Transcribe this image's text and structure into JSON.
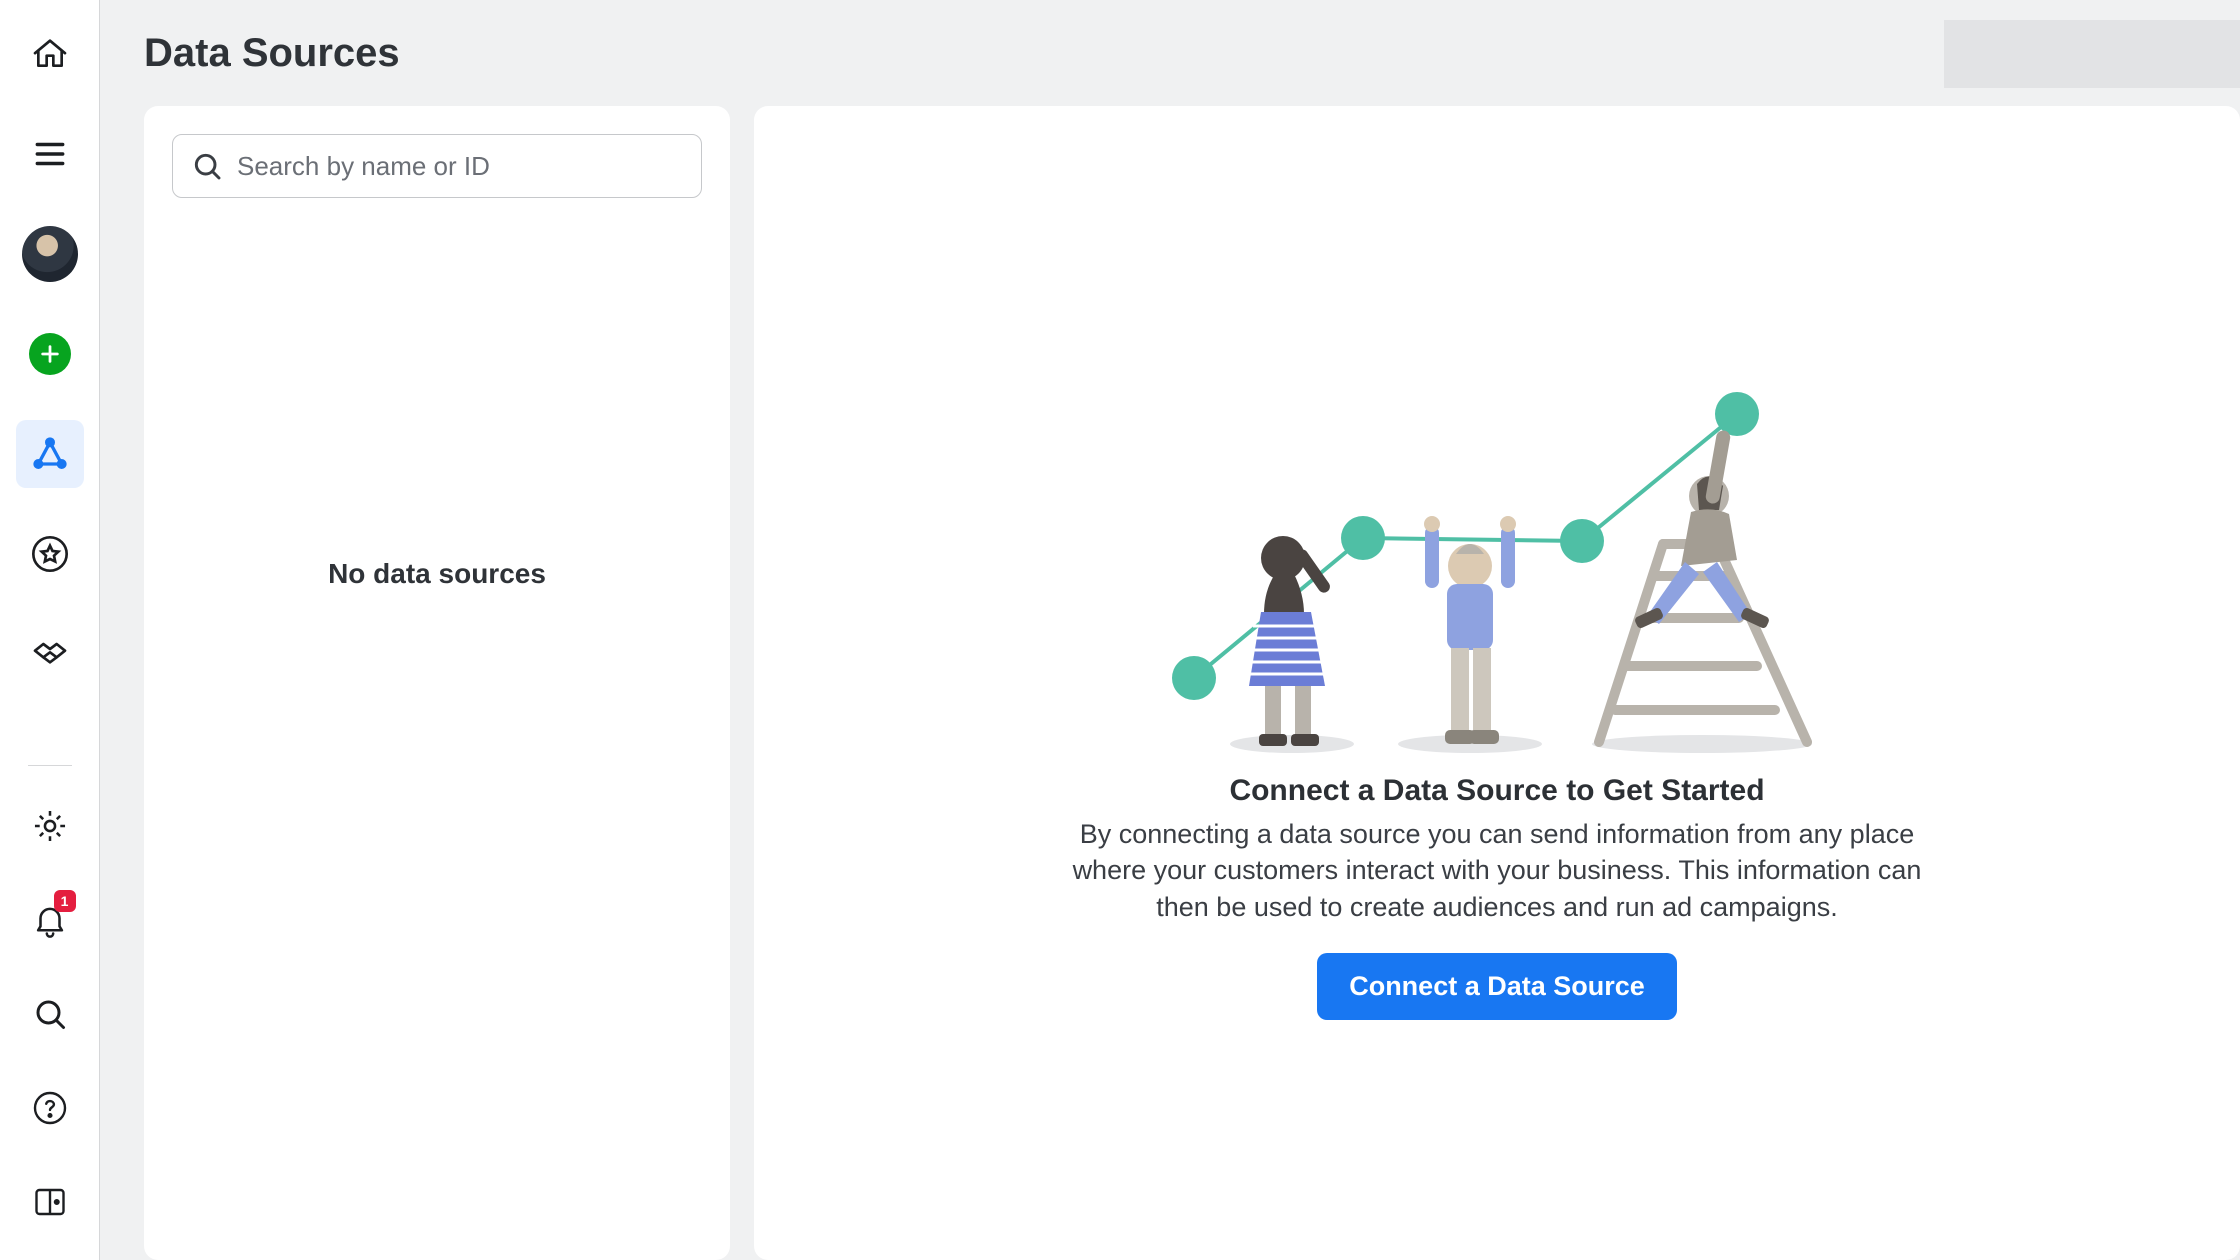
{
  "page": {
    "title": "Data Sources"
  },
  "search": {
    "placeholder": "Search by name or ID"
  },
  "sidePanel": {
    "emptyMessage": "No data sources"
  },
  "hero": {
    "title": "Connect a Data Source to Get Started",
    "description": "By connecting a data source you can send information from any place where your customers interact with your business. This information can then be used to create audiences and run ad campaigns.",
    "cta": "Connect a Data Source"
  },
  "nav": {
    "notificationsBadge": "1"
  }
}
